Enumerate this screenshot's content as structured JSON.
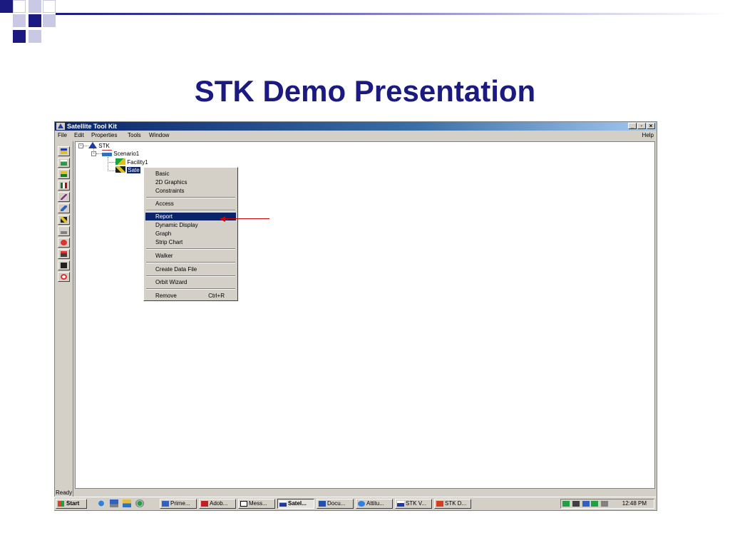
{
  "slide": {
    "title": "STK Demo Presentation",
    "colors": {
      "title": "#1a1a80",
      "accent": "#1a1a80",
      "rule_light": "#c9c9e6"
    }
  },
  "window": {
    "title": "Satellite Tool Kit",
    "controls": [
      "_",
      "·",
      "×"
    ],
    "menu": [
      "File",
      "Edit",
      "Properties",
      "Tools",
      "Window"
    ],
    "help": "Help",
    "status": "Ready"
  },
  "toolbar_icons": [
    "satellite-insert-icon",
    "facility-insert-icon",
    "vehicle-icon",
    "building-icon",
    "missile-icon",
    "aircraft-icon",
    "satellite-icon",
    "ship-icon",
    "target-icon",
    "chart-icon",
    "star-icon",
    "area-target-icon"
  ],
  "tree": {
    "root": "STK",
    "scenario": "Scenario1",
    "facility": "Facility1",
    "satellite": "Sate"
  },
  "context_menu": {
    "items": [
      {
        "label": "Basic"
      },
      {
        "label": "2D Graphics"
      },
      {
        "label": "Constraints"
      },
      {
        "label": "Access"
      },
      {
        "label": "Report"
      },
      {
        "label": "Dynamic Display"
      },
      {
        "label": "Graph"
      },
      {
        "label": "Strip Chart"
      },
      {
        "label": "Walker"
      },
      {
        "label": "Create Data File"
      },
      {
        "label": "Orbit Wizard"
      },
      {
        "label": "Remove",
        "shortcut": "Ctrl+R"
      }
    ],
    "highlighted": "Report"
  },
  "taskbar": {
    "start": "Start",
    "tasks": [
      "Prime...",
      "Adob...",
      "Mess...",
      "Satel...",
      "Docu...",
      "Attitu...",
      "STK V...",
      "STK D..."
    ],
    "active_task": "Satel...",
    "clock": "12:48 PM"
  }
}
